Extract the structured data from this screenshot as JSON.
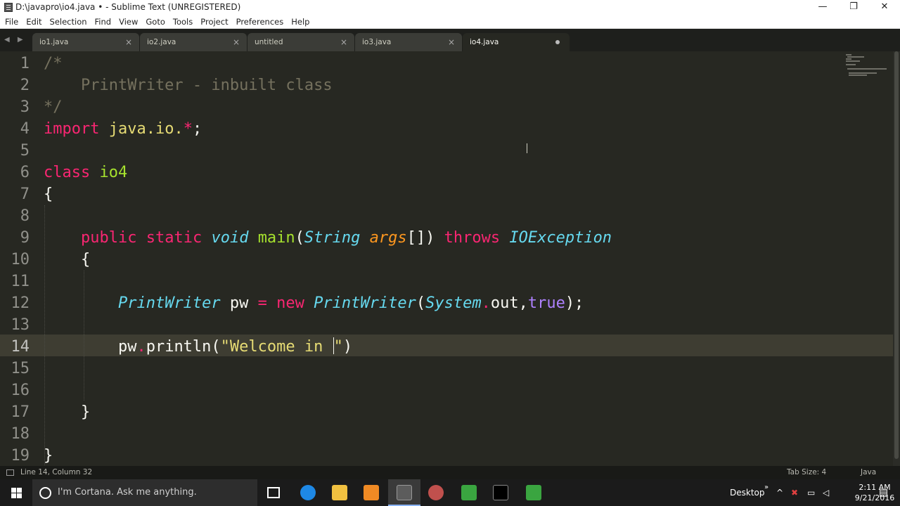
{
  "window": {
    "title": "D:\\javapro\\io4.java • - Sublime Text (UNREGISTERED)",
    "minimize": "—",
    "maximize": "❐",
    "close": "✕"
  },
  "menu": [
    "File",
    "Edit",
    "Selection",
    "Find",
    "View",
    "Goto",
    "Tools",
    "Project",
    "Preferences",
    "Help"
  ],
  "tabs": [
    {
      "label": "io1.java",
      "state": "close"
    },
    {
      "label": "io2.java",
      "state": "close"
    },
    {
      "label": "untitled",
      "state": "close"
    },
    {
      "label": "io3.java",
      "state": "close"
    },
    {
      "label": "io4.java",
      "state": "modified"
    }
  ],
  "tab_nav": "◀ ▶",
  "editor": {
    "current_line": 14,
    "line_numbers": [
      "1",
      "2",
      "3",
      "4",
      "5",
      "6",
      "7",
      "8",
      "9",
      "10",
      "11",
      "12",
      "13",
      "14",
      "15",
      "16",
      "17",
      "18",
      "19"
    ]
  },
  "status": {
    "position": "Line 14, Column 32",
    "tab_size": "Tab Size: 4",
    "syntax": "Java"
  },
  "taskbar": {
    "cortana_placeholder": "I'm Cortana. Ask me anything.",
    "desktop_label": "Desktop",
    "time": "2:11 AM",
    "date": "9/21/2016"
  }
}
